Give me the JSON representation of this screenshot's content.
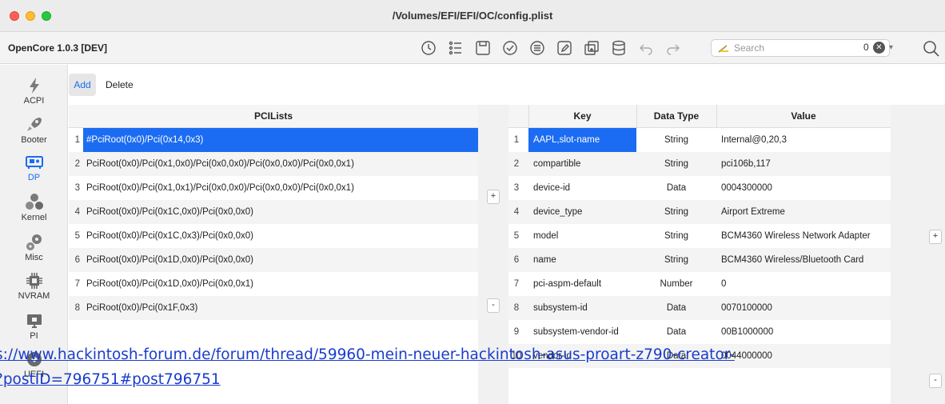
{
  "window": {
    "title": "/Volumes/EFI/EFI/OC/config.plist",
    "app_version": "OpenCore 1.0.3 [DEV]"
  },
  "toolbar": {
    "icons": [
      "clock-icon",
      "list-icon",
      "save-icon",
      "checkmark-icon",
      "menu-list-icon",
      "edit-doc-icon",
      "duplicate-icon",
      "database-icon",
      "undo-icon",
      "redo-icon"
    ],
    "search_placeholder": "Search",
    "search_count": "0"
  },
  "sidebar": {
    "items": [
      {
        "label": "ACPI",
        "icon": "lightning-icon",
        "active": false
      },
      {
        "label": "Booter",
        "icon": "rocket-icon",
        "active": false
      },
      {
        "label": "DP",
        "icon": "device-icon",
        "active": true
      },
      {
        "label": "Kernel",
        "icon": "kernel-icon",
        "active": false
      },
      {
        "label": "Misc",
        "icon": "gears-icon",
        "active": false
      },
      {
        "label": "NVRAM",
        "icon": "chip-icon",
        "active": false
      },
      {
        "label": "PI",
        "icon": "monitor-icon",
        "active": false
      },
      {
        "label": "UEFI",
        "icon": "uefi-icon",
        "active": false
      }
    ]
  },
  "actions": {
    "add": "Add",
    "delete": "Delete"
  },
  "pci_table": {
    "header": "PCILists",
    "rows": [
      {
        "idx": "1",
        "value": "#PciRoot(0x0)/Pci(0x14,0x3)"
      },
      {
        "idx": "2",
        "value": "PciRoot(0x0)/Pci(0x1,0x0)/Pci(0x0,0x0)/Pci(0x0,0x0)/Pci(0x0,0x1)"
      },
      {
        "idx": "3",
        "value": "PciRoot(0x0)/Pci(0x1,0x1)/Pci(0x0,0x0)/Pci(0x0,0x0)/Pci(0x0,0x1)"
      },
      {
        "idx": "4",
        "value": "PciRoot(0x0)/Pci(0x1C,0x0)/Pci(0x0,0x0)"
      },
      {
        "idx": "5",
        "value": "PciRoot(0x0)/Pci(0x1C,0x3)/Pci(0x0,0x0)"
      },
      {
        "idx": "6",
        "value": "PciRoot(0x0)/Pci(0x1D,0x0)/Pci(0x0,0x0)"
      },
      {
        "idx": "7",
        "value": "PciRoot(0x0)/Pci(0x1D,0x0)/Pci(0x0,0x1)"
      },
      {
        "idx": "8",
        "value": "PciRoot(0x0)/Pci(0x1F,0x3)"
      }
    ]
  },
  "middle_buttons": {
    "plus": "+",
    "minus": "-"
  },
  "props_table": {
    "headers": {
      "key": "Key",
      "type": "Data Type",
      "value": "Value"
    },
    "rows": [
      {
        "idx": "1",
        "key": "AAPL,slot-name",
        "type": "String",
        "value": "Internal@0,20,3"
      },
      {
        "idx": "2",
        "key": "compartible",
        "type": "String",
        "value": "pci106b,117"
      },
      {
        "idx": "3",
        "key": "device-id",
        "type": "Data",
        "value": "0004300000"
      },
      {
        "idx": "4",
        "key": "device_type",
        "type": "String",
        "value": "Airport Extreme"
      },
      {
        "idx": "5",
        "key": "model",
        "type": "String",
        "value": "BCM4360 Wireless Network Adapter"
      },
      {
        "idx": "6",
        "key": "name",
        "type": "String",
        "value": "BCM4360 Wireless/Bluetooth Card"
      },
      {
        "idx": "7",
        "key": "pci-aspm-default",
        "type": "Number",
        "value": "0"
      },
      {
        "idx": "8",
        "key": "subsystem-id",
        "type": "Data",
        "value": "0070100000"
      },
      {
        "idx": "9",
        "key": "subsystem-vendor-id",
        "type": "Data",
        "value": "00B1000000"
      },
      {
        "idx": "10",
        "key": "vendor-id",
        "type": "Data",
        "value": "0044000000"
      }
    ]
  },
  "right_buttons": {
    "plus": "+",
    "minus": "-"
  },
  "overlay": {
    "link_text": "s://www.hackintosh-forum.de/forum/thread/59960-mein-neuer-hackintosh-asus-proart-z790-creator-\n?postID=796751#post796751"
  },
  "colors": {
    "accent": "#1b6cf2",
    "link": "#1a3ccc"
  }
}
